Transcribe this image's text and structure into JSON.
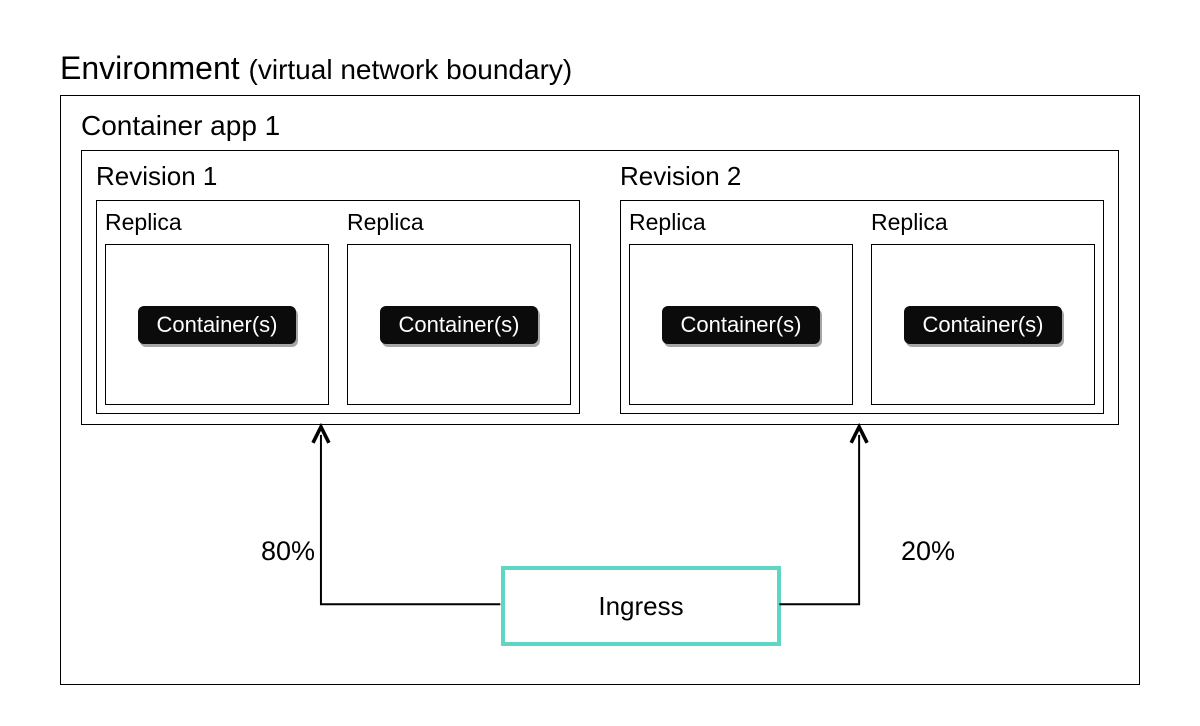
{
  "environment": {
    "title_main": "Environment",
    "title_sub": "(virtual network boundary)"
  },
  "app": {
    "title": "Container app 1",
    "revisions": [
      {
        "label": "Revision 1",
        "replicas": [
          {
            "label": "Replica",
            "container_label": "Container(s)"
          },
          {
            "label": "Replica",
            "container_label": "Container(s)"
          }
        ]
      },
      {
        "label": "Revision 2",
        "replicas": [
          {
            "label": "Replica",
            "container_label": "Container(s)"
          },
          {
            "label": "Replica",
            "container_label": "Container(s)"
          }
        ]
      }
    ]
  },
  "ingress": {
    "label": "Ingress",
    "traffic_split": [
      {
        "target": "Revision 1",
        "percent_label": "80%"
      },
      {
        "target": "Revision 2",
        "percent_label": "20%"
      }
    ]
  }
}
